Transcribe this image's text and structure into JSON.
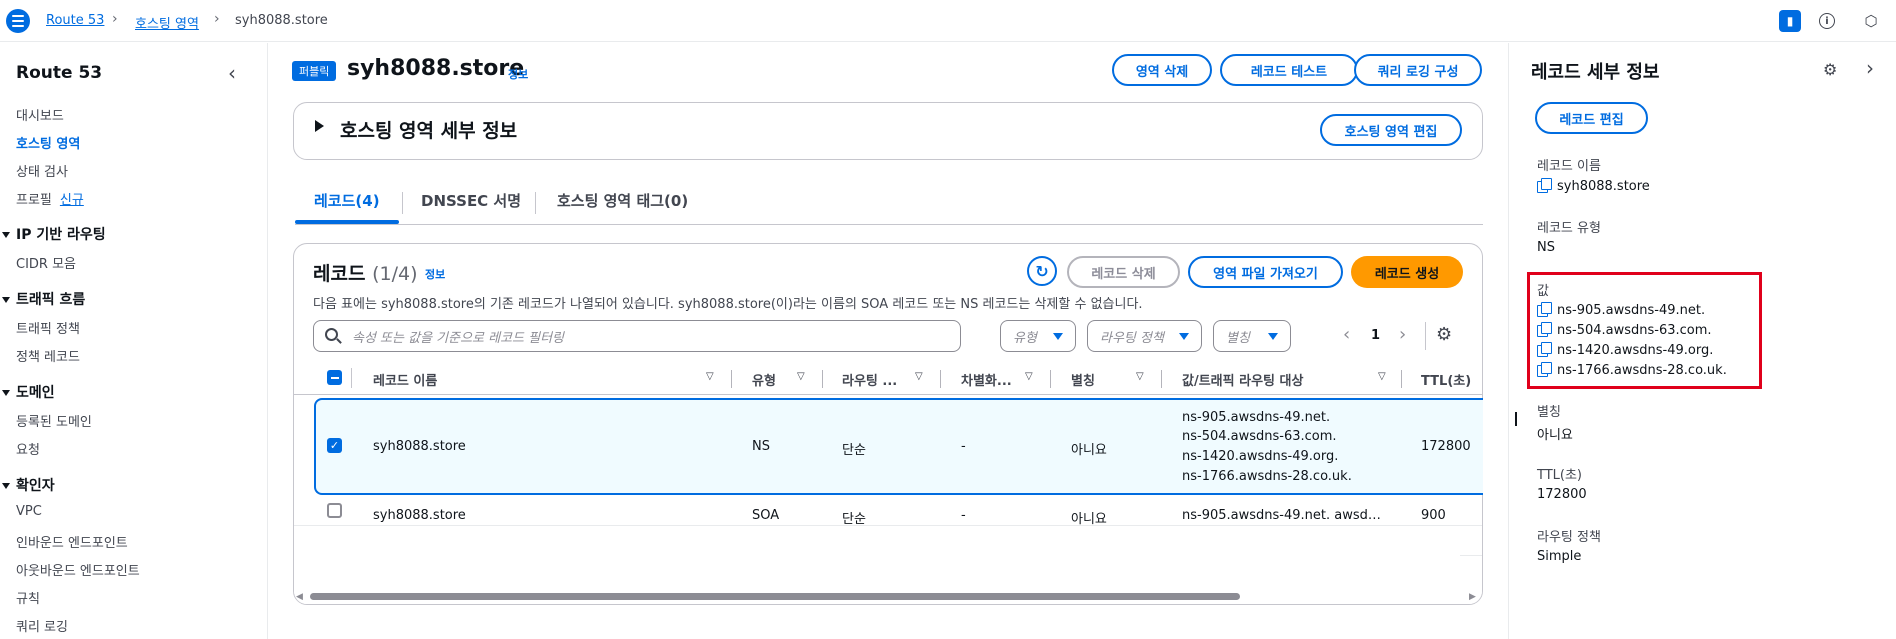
{
  "breadcrumb": [
    "Route 53",
    "호스팅 영역",
    "syh8088.store"
  ],
  "sidebar": {
    "title": "Route 53",
    "items_top": [
      "대시보드",
      "호스팅 영역",
      "상태 검사",
      "프로필"
    ],
    "new_badge": "신규",
    "sections": [
      {
        "title": "IP 기반 라우팅",
        "items": [
          "CIDR 모음"
        ]
      },
      {
        "title": "트래픽 흐름",
        "items": [
          "트래픽 정책",
          "정책 레코드"
        ]
      },
      {
        "title": "도메인",
        "items": [
          "등록된 도메인",
          "요청"
        ]
      },
      {
        "title": "확인자",
        "items": [
          "VPC",
          "인바운드 엔드포인트",
          "아웃바운드 엔드포인트",
          "규칙",
          "쿼리 로깅"
        ]
      }
    ]
  },
  "zone": {
    "badge": "퍼블릭",
    "name": "syh8088.store",
    "info": "정보",
    "buttons": [
      "영역 삭제",
      "레코드 테스트",
      "쿼리 로깅 구성"
    ],
    "details_title": "호스팅 영역 세부 정보",
    "edit_button": "호스팅 영역 편집"
  },
  "tabs": [
    "레코드(4)",
    "DNSSEC 서명",
    "호스팅 영역 태그(0)"
  ],
  "records": {
    "title": "레코드",
    "count": "(1/4)",
    "info": "정보",
    "description": "다음 표에는 syh8088.store의 기존 레코드가 나열되어 있습니다. syh8088.store(이)라는 이름의 SOA 레코드 또는 NS 레코드는 삭제할 수 없습니다.",
    "buttons": {
      "delete": "레코드 삭제",
      "import": "영역 파일 가져오기",
      "create": "레코드 생성"
    },
    "filter_placeholder": "속성 또는 값을 기준으로 레코드 필터링",
    "dropdowns": [
      "유형",
      "라우팅 정책",
      "별칭"
    ],
    "page": "1",
    "columns": [
      "레코드 이름",
      "유형",
      "라우팅 ...",
      "차별화...",
      "별칭",
      "값/트래픽 라우팅 대상",
      "TTL(초)"
    ],
    "rows": [
      {
        "name": "syh8088.store",
        "type": "NS",
        "routing": "단순",
        "diff": "-",
        "alias": "아니요",
        "values": [
          "ns-905.awsdns-49.net.",
          "ns-504.awsdns-63.com.",
          "ns-1420.awsdns-49.org.",
          "ns-1766.awsdns-28.co.uk."
        ],
        "ttl": "172800",
        "selected": true
      },
      {
        "name": "syh8088.store",
        "type": "SOA",
        "routing": "단순",
        "diff": "-",
        "alias": "아니요",
        "values": [
          "ns-905.awsdns-49.net. awsd…"
        ],
        "ttl": "900",
        "selected": false
      }
    ]
  },
  "details": {
    "title": "레코드 세부 정보",
    "edit_button": "레코드 편집",
    "name_label": "레코드 이름",
    "name_value": "syh8088.store",
    "type_label": "레코드 유형",
    "type_value": "NS",
    "value_label": "값",
    "values": [
      "ns-905.awsdns-49.net.",
      "ns-504.awsdns-63.com.",
      "ns-1420.awsdns-49.org.",
      "ns-1766.awsdns-28.co.uk."
    ],
    "alias_label": "별칭",
    "alias_value": "아니요",
    "ttl_label": "TTL(초)",
    "ttl_value": "172800",
    "policy_label": "라우팅 정책",
    "policy_value": "Simple"
  },
  "colors": {
    "accent": "#006ce0",
    "primary_button": "#ff9900",
    "highlight_border": "#e0001b"
  }
}
